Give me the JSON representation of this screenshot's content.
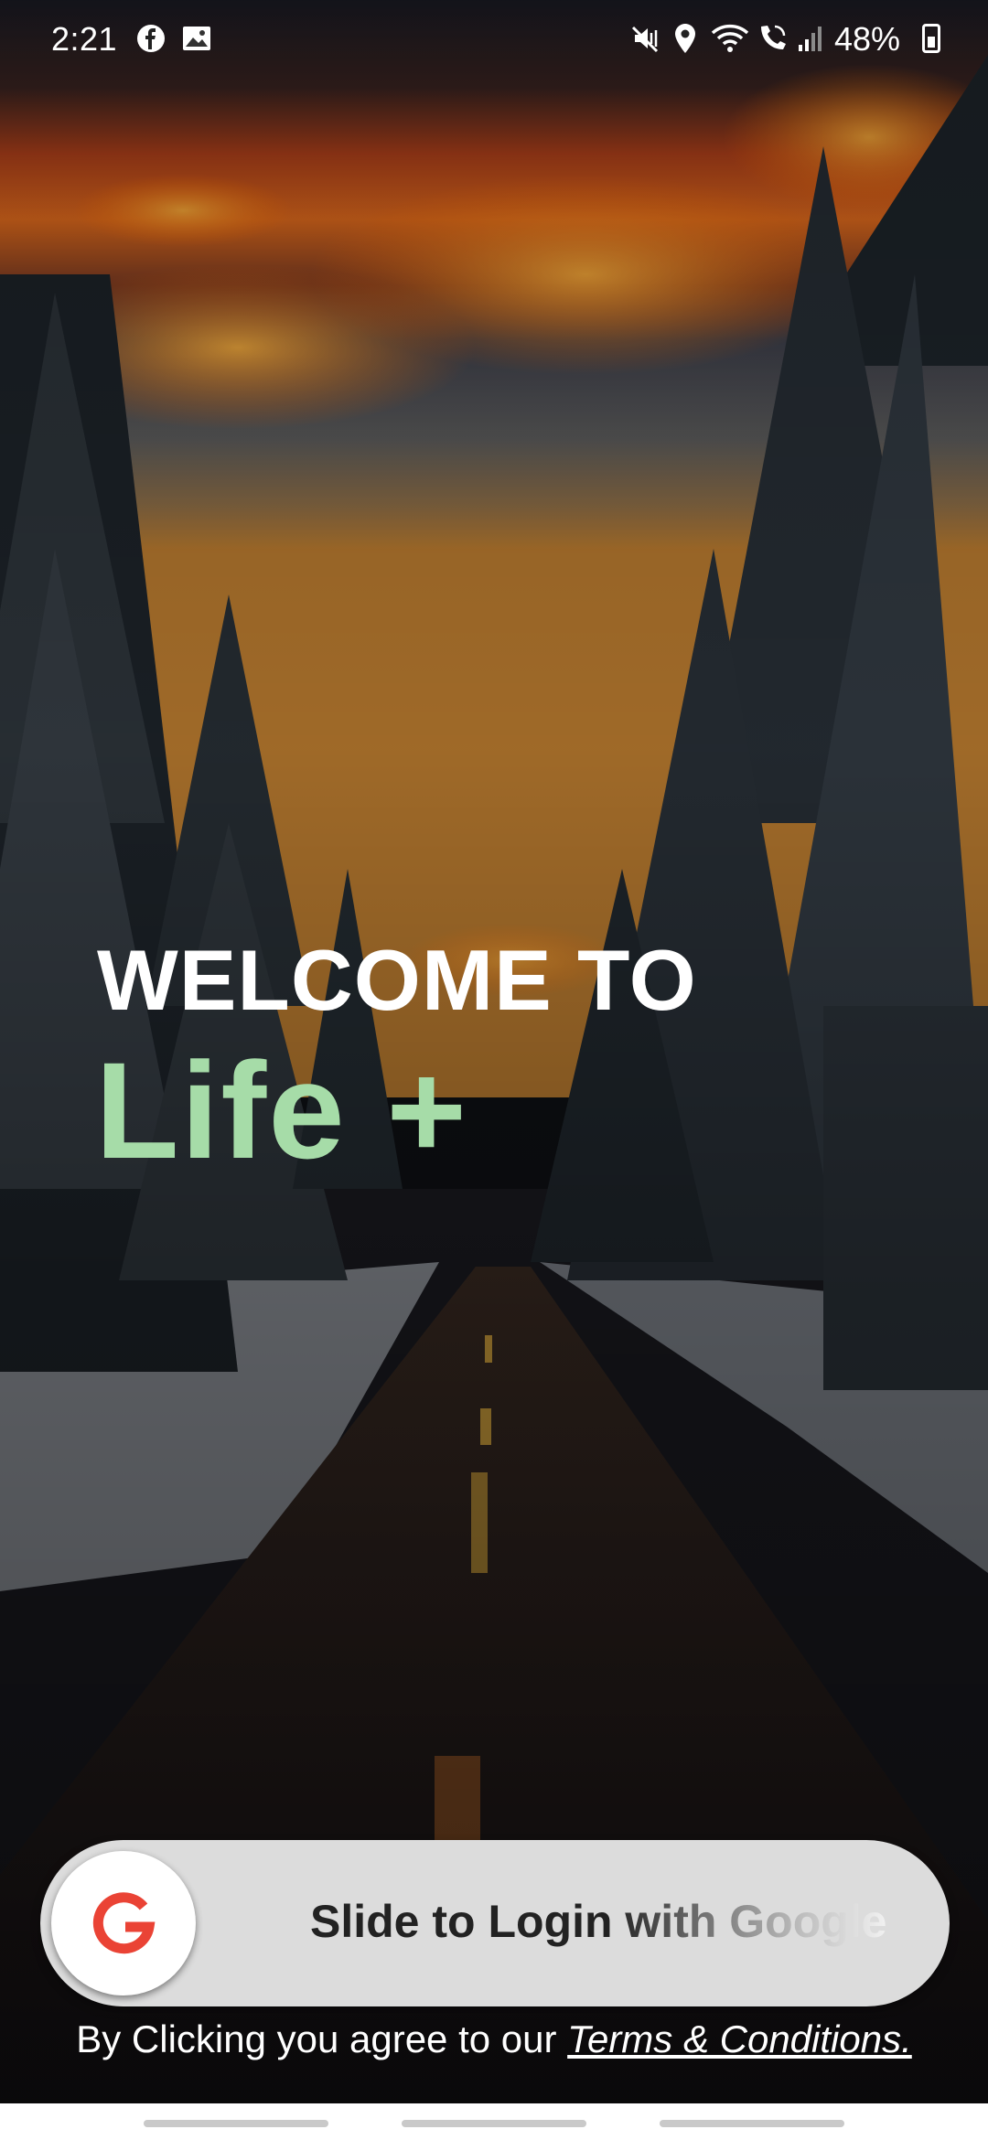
{
  "status_bar": {
    "time": "2:21",
    "battery": "48%",
    "icons": [
      "facebook-icon",
      "gallery-icon",
      "mute-icon",
      "location-icon",
      "wifi-icon",
      "wifi-calling-icon",
      "signal-icon",
      "battery-icon"
    ]
  },
  "hero": {
    "welcome": "WELCOME TO",
    "app_name": "Life +",
    "app_name_color": "#a6dca8"
  },
  "login": {
    "slide_label": "Slide to Login with Google",
    "google_letter": "G",
    "google_color": "#ea4335"
  },
  "footer": {
    "terms_prefix": "By Clicking you agree to our ",
    "terms_link": "Terms & Conditions."
  }
}
